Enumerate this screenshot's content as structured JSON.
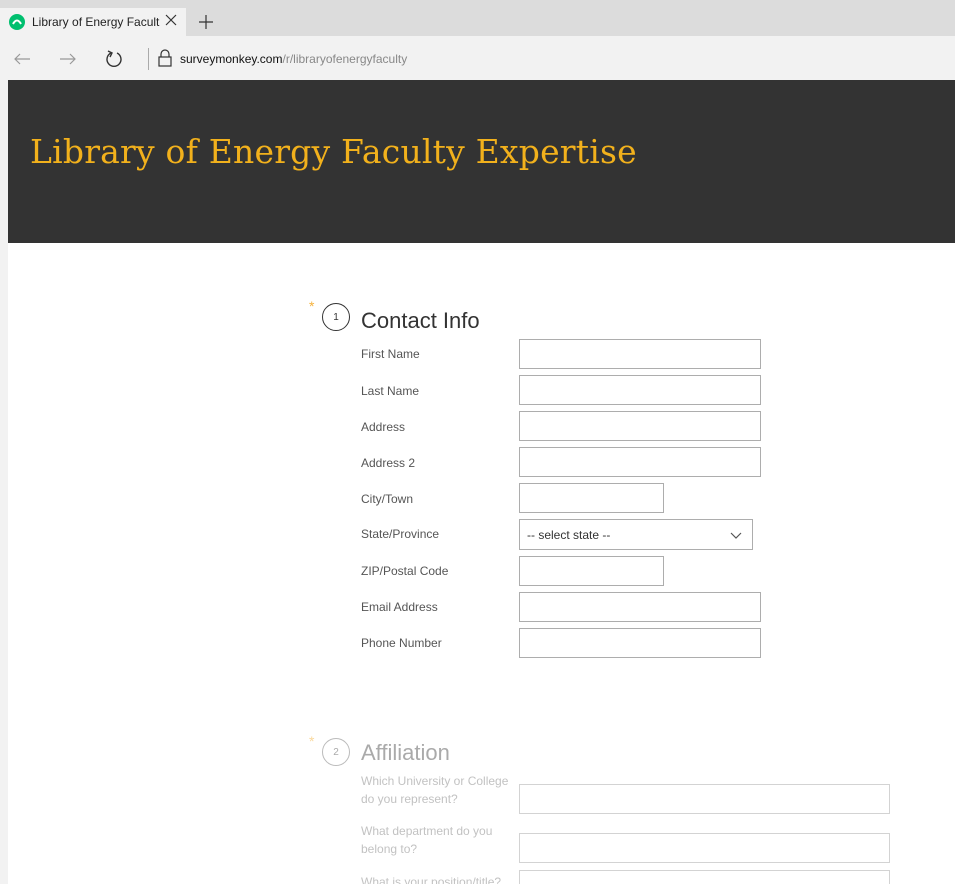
{
  "browser": {
    "tab_title": "Library of Energy Facult",
    "url_domain": "surveymonkey.com",
    "url_path": "/r/libraryofenergyfaculty"
  },
  "banner": {
    "title": "Library of Energy Faculty Expertise",
    "background": "#333333",
    "title_color": "#f2b11c"
  },
  "questions": [
    {
      "required_mark": "*",
      "number": "1",
      "title": "Contact Info",
      "fields": [
        {
          "label": "First Name",
          "value": ""
        },
        {
          "label": "Last Name",
          "value": ""
        },
        {
          "label": "Address",
          "value": ""
        },
        {
          "label": "Address 2",
          "value": ""
        },
        {
          "label": "City/Town",
          "value": ""
        },
        {
          "label": "State/Province",
          "value": "-- select state --"
        },
        {
          "label": "ZIP/Postal Code",
          "value": ""
        },
        {
          "label": "Email Address",
          "value": ""
        },
        {
          "label": "Phone Number",
          "value": ""
        }
      ]
    },
    {
      "required_mark": "*",
      "number": "2",
      "title": "Affiliation",
      "fields": [
        {
          "label": "Which University or College do you represent?",
          "value": ""
        },
        {
          "label": "What department do you belong to?",
          "value": ""
        },
        {
          "label": "What is your position/title?",
          "value": ""
        }
      ]
    }
  ],
  "colors": {
    "accent": "#f2b11c",
    "required_star": "#f5b23c",
    "favicon": "#00bf6f"
  },
  "icons": [
    "surveymonkey-favicon",
    "close-icon",
    "plus-icon",
    "back-arrow-icon",
    "forward-arrow-icon",
    "refresh-icon",
    "lock-icon",
    "chevron-down-icon"
  ]
}
